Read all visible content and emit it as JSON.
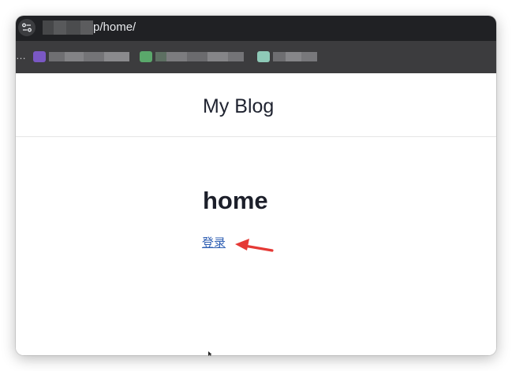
{
  "browser": {
    "url_visible": "p/home/",
    "icons": {
      "site_info": "tune-icon",
      "bookmark_overflow": "ellipsis-icon"
    },
    "bookmark_overflow_label": "…",
    "bookmark_colors": [
      "#7a58c4",
      "#5aa86b",
      "#8ec9b7"
    ]
  },
  "site": {
    "title": "My Blog"
  },
  "main": {
    "heading": "home",
    "login_link": "登录"
  },
  "annotation": {
    "arrow_color": "#e53935"
  }
}
